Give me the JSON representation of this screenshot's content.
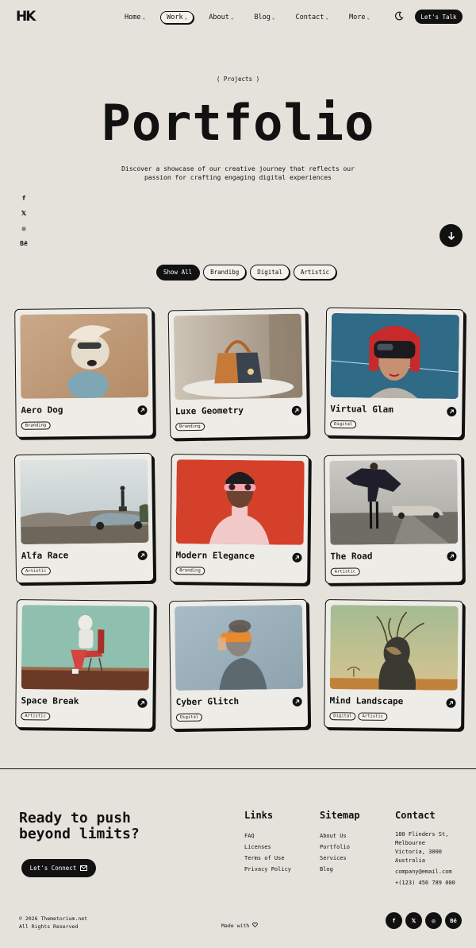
{
  "nav": {
    "logo": "HK",
    "items": [
      {
        "label": "Home",
        "caret": "⌄"
      },
      {
        "label": "Work",
        "caret": "⌄"
      },
      {
        "label": "About",
        "caret": "⌄"
      },
      {
        "label": "Blog",
        "caret": "⌄"
      },
      {
        "label": "Contact",
        "caret": "⌄"
      },
      {
        "label": "More",
        "caret": "⌄"
      }
    ],
    "cta": "Let's Talk"
  },
  "hero": {
    "eyebrow": "( Projects )",
    "title": "Portfolio",
    "subtitle": "Discover a showcase of our creative journey that reflects our passion for crafting engaging digital experiences"
  },
  "social": [
    "f",
    "𝕏",
    "◎",
    "Bē"
  ],
  "filters": [
    "Show All",
    "Brandibg",
    "Digital",
    "Artistic"
  ],
  "projects": [
    {
      "title": "Aero Dog",
      "tags": [
        "Branding"
      ]
    },
    {
      "title": "Luxe Geometry",
      "tags": [
        "Branding"
      ]
    },
    {
      "title": "Virtual Glam",
      "tags": [
        "Digital"
      ]
    },
    {
      "title": "Alfa Race",
      "tags": [
        "Artistic"
      ]
    },
    {
      "title": "Modern Elegance",
      "tags": [
        "Branding"
      ]
    },
    {
      "title": "The Road",
      "tags": [
        "Artistic"
      ]
    },
    {
      "title": "Space Break",
      "tags": [
        "Artistic"
      ]
    },
    {
      "title": "Cyber Glitch",
      "tags": [
        "Digital"
      ]
    },
    {
      "title": "Mind Landscape",
      "tags": [
        "Digital",
        "Artistic"
      ]
    }
  ],
  "footer": {
    "cta_title_1": "Ready to push",
    "cta_title_2": "beyond limits?",
    "cta_button": "Let's Connect",
    "links_title": "Links",
    "links": [
      "FAQ",
      "Licenses",
      "Terms of Use",
      "Privacy Policy"
    ],
    "sitemap_title": "Sitemap",
    "sitemap": [
      "About Us",
      "Portfolio",
      "Services",
      "Blog"
    ],
    "contact_title": "Contact",
    "address": [
      "180 Flinders St,",
      "Melbourne",
      "Victoria, 3000",
      "Australia"
    ],
    "email": "company@email.com",
    "phone": "+(123) 456 789 000",
    "copyright_1": "© 2026 Themetorium.net",
    "copyright_2": "All Rights Reserved",
    "made_with": "Made with",
    "social": [
      "f",
      "𝕏",
      "◎",
      "Bē"
    ]
  }
}
